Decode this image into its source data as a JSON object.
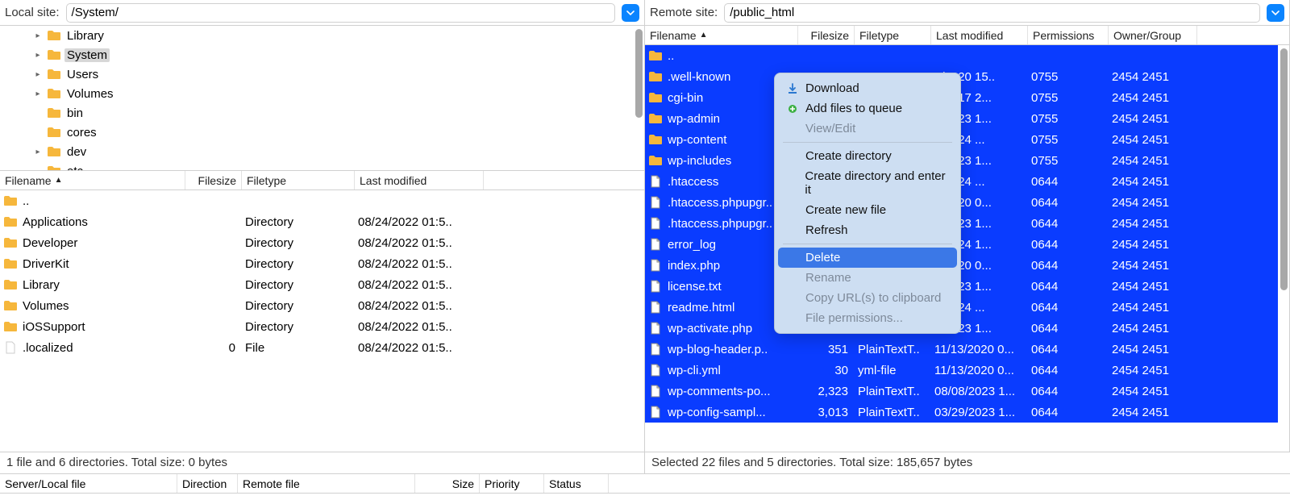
{
  "local": {
    "label": "Local site:",
    "path": "/System/",
    "tree": [
      {
        "indent": 2,
        "exp": ">",
        "name": "Library"
      },
      {
        "indent": 2,
        "exp": ">",
        "name": "System",
        "selected": true
      },
      {
        "indent": 2,
        "exp": ">",
        "name": "Users"
      },
      {
        "indent": 2,
        "exp": ">",
        "name": "Volumes"
      },
      {
        "indent": 2,
        "exp": "",
        "name": "bin"
      },
      {
        "indent": 2,
        "exp": "",
        "name": "cores"
      },
      {
        "indent": 2,
        "exp": ">",
        "name": "dev"
      },
      {
        "indent": 2,
        "exp": "",
        "name": "etc"
      }
    ],
    "headers": {
      "filename": "Filename",
      "filesize": "Filesize",
      "filetype": "Filetype",
      "lastmod": "Last modified"
    },
    "rows": [
      {
        "icon": "folder",
        "name": "..",
        "size": "",
        "type": "",
        "mod": ""
      },
      {
        "icon": "folder",
        "name": "Applications",
        "size": "",
        "type": "Directory",
        "mod": "08/24/2022 01:5.."
      },
      {
        "icon": "folder",
        "name": "Developer",
        "size": "",
        "type": "Directory",
        "mod": "08/24/2022 01:5.."
      },
      {
        "icon": "folder",
        "name": "DriverKit",
        "size": "",
        "type": "Directory",
        "mod": "08/24/2022 01:5.."
      },
      {
        "icon": "folder",
        "name": "Library",
        "size": "",
        "type": "Directory",
        "mod": "08/24/2022 01:5.."
      },
      {
        "icon": "folder",
        "name": "Volumes",
        "size": "",
        "type": "Directory",
        "mod": "08/24/2022 01:5.."
      },
      {
        "icon": "folder",
        "name": "iOSSupport",
        "size": "",
        "type": "Directory",
        "mod": "08/24/2022 01:5.."
      },
      {
        "icon": "file",
        "name": ".localized",
        "size": "0",
        "type": "File",
        "mod": "08/24/2022 01:5.."
      }
    ],
    "status": "1 file and 6 directories. Total size: 0 bytes"
  },
  "remote": {
    "label": "Remote site:",
    "path": "/public_html",
    "headers": {
      "filename": "Filename",
      "filesize": "Filesize",
      "filetype": "Filetype",
      "lastmod": "Last modified",
      "permissions": "Permissions",
      "owner": "Owner/Group"
    },
    "rows": [
      {
        "icon": "folder",
        "name": "..",
        "size": "",
        "type": "",
        "mod": "",
        "perm": "",
        "own": ""
      },
      {
        "icon": "folder",
        "name": ".well-known",
        "size": "",
        "type": "",
        "mod": "2/2020 15..",
        "perm": "0755",
        "own": "2454 2451"
      },
      {
        "icon": "folder",
        "name": "cgi-bin",
        "size": "",
        "type": "",
        "mod": "2/2017 2...",
        "perm": "0755",
        "own": "2454 2451"
      },
      {
        "icon": "folder",
        "name": "wp-admin",
        "size": "",
        "type": "",
        "mod": "8/2023 1...",
        "perm": "0755",
        "own": "2454 2451"
      },
      {
        "icon": "folder",
        "name": "wp-content",
        "size": "",
        "type": "",
        "mod": "8/2024 ...",
        "perm": "0755",
        "own": "2454 2451"
      },
      {
        "icon": "folder",
        "name": "wp-includes",
        "size": "",
        "type": "",
        "mod": "7/2023 1...",
        "perm": "0755",
        "own": "2454 2451"
      },
      {
        "icon": "file",
        "name": ".htaccess",
        "size": "",
        "type": "",
        "mod": "8/2024 ...",
        "perm": "0644",
        "own": "2454 2451"
      },
      {
        "icon": "file",
        "name": ".htaccess.phpupgr..",
        "size": "",
        "type": "",
        "mod": "7/2020 0...",
        "perm": "0644",
        "own": "2454 2451"
      },
      {
        "icon": "file",
        "name": ".htaccess.phpupgr..",
        "size": "",
        "type": "",
        "mod": "7/2023 1...",
        "perm": "0644",
        "own": "2454 2451"
      },
      {
        "icon": "file",
        "name": "error_log",
        "size": "",
        "type": "",
        "mod": "7/2024 1...",
        "perm": "0644",
        "own": "2454 2451"
      },
      {
        "icon": "file",
        "name": "index.php",
        "size": "",
        "type": "",
        "mod": "7/2020 0...",
        "perm": "0644",
        "own": "2454 2451"
      },
      {
        "icon": "file",
        "name": "license.txt",
        "size": "",
        "type": "",
        "mod": "7/2023 1...",
        "perm": "0644",
        "own": "2454 2451"
      },
      {
        "icon": "file",
        "name": "readme.html",
        "size": "",
        "type": "",
        "mod": "0/2024 ...",
        "perm": "0644",
        "own": "2454 2451"
      },
      {
        "icon": "file",
        "name": "wp-activate.php",
        "size": "",
        "type": "",
        "mod": "8/2023 1...",
        "perm": "0644",
        "own": "2454 2451"
      },
      {
        "icon": "file",
        "name": "wp-blog-header.p..",
        "size": "351",
        "type": "PlainTextT..",
        "mod": "11/13/2020 0...",
        "perm": "0644",
        "own": "2454 2451"
      },
      {
        "icon": "file",
        "name": "wp-cli.yml",
        "size": "30",
        "type": "yml-file",
        "mod": "11/13/2020 0...",
        "perm": "0644",
        "own": "2454 2451"
      },
      {
        "icon": "file",
        "name": "wp-comments-po...",
        "size": "2,323",
        "type": "PlainTextT..",
        "mod": "08/08/2023 1...",
        "perm": "0644",
        "own": "2454 2451"
      },
      {
        "icon": "file",
        "name": "wp-config-sampl...",
        "size": "3,013",
        "type": "PlainTextT..",
        "mod": "03/29/2023 1...",
        "perm": "0644",
        "own": "2454 2451"
      }
    ],
    "status": "Selected 22 files and 5 directories. Total size: 185,657 bytes"
  },
  "context_menu": {
    "download": "Download",
    "add_queue": "Add files to queue",
    "view_edit": "View/Edit",
    "create_dir": "Create directory",
    "create_dir_enter": "Create directory and enter it",
    "create_file": "Create new file",
    "refresh": "Refresh",
    "delete": "Delete",
    "rename": "Rename",
    "copy_url": "Copy URL(s) to clipboard",
    "file_perms": "File permissions..."
  },
  "queue_headers": {
    "server": "Server/Local file",
    "direction": "Direction",
    "remote": "Remote file",
    "size": "Size",
    "priority": "Priority",
    "status": "Status"
  }
}
